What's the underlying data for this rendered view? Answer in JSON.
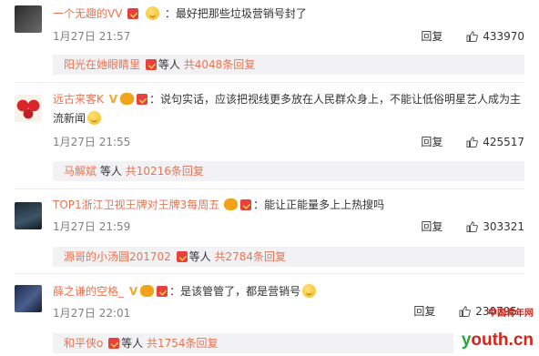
{
  "comments": [
    {
      "username": "一个无趣的VV",
      "text": "：最好把那些垃圾营销号封了",
      "time": "1月27日 21:57",
      "reply_label": "回复",
      "likes": "433970",
      "reply_user": "阳光在她眼睛里",
      "reply_mid": "等人",
      "reply_count": "共4048条回复"
    },
    {
      "username": "远古来客K",
      "text": "：说句实话，应该把视线更多放在人民群众身上，不能让低俗明星艺人成为主流新闻",
      "time": "1月27日 21:55",
      "reply_label": "回复",
      "likes": "425517",
      "reply_user": "马解斌",
      "reply_mid": "等人",
      "reply_count": "共10216条回复"
    },
    {
      "username": "TOP1浙江卫视王牌对王牌3每周五",
      "text": "：能让正能量多上上热搜吗",
      "time": "1月27日 21:59",
      "reply_label": "回复",
      "likes": "303321",
      "reply_user": "源哥的小汤圆201702",
      "reply_mid": "等人",
      "reply_count": "共2784条回复"
    },
    {
      "username": "薛之谦的空格_",
      "text": "：是该管管了，都是营销号",
      "time": "1月27日 22:01",
      "reply_label": "回复",
      "likes": "230795",
      "reply_user": "和平侠o",
      "reply_mid": "等人",
      "reply_count": "共1754条回复"
    }
  ],
  "watermark": {
    "top": "中国青年网",
    "y": "y",
    "main": "outh.cn"
  },
  "colors": {
    "username": "#eb7350",
    "meta": "#808080",
    "reply_bg": "#f2f2f5",
    "badge": "#e8413b"
  }
}
